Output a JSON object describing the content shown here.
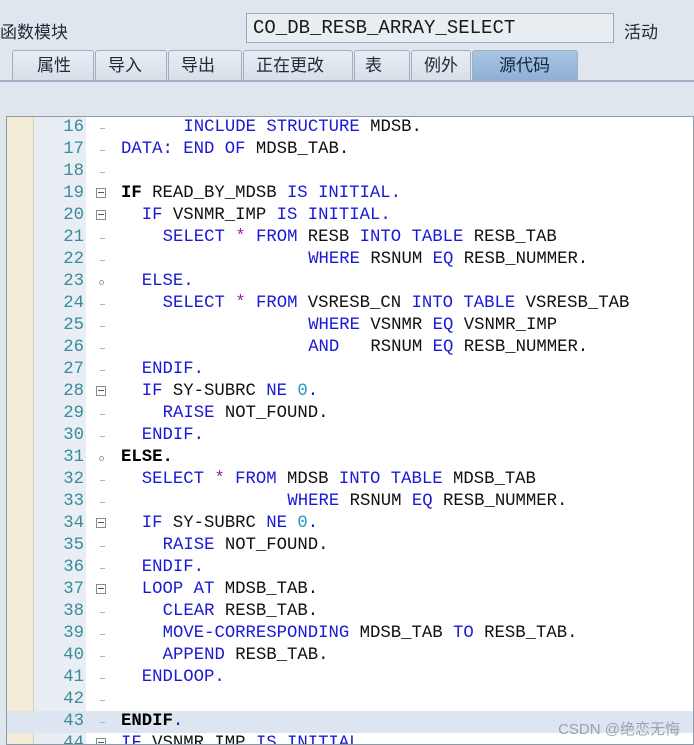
{
  "header": {
    "function_module_label": "函数模块",
    "function_module_value": "CO_DB_RESB_ARRAY_SELECT",
    "status": "活动"
  },
  "tabs": [
    {
      "label": "属性",
      "active": false
    },
    {
      "label": "导入",
      "active": false
    },
    {
      "label": "导出",
      "active": false
    },
    {
      "label": "正在更改",
      "active": false
    },
    {
      "label": "表",
      "active": false
    },
    {
      "label": "例外",
      "active": false
    },
    {
      "label": "源代码",
      "active": true
    }
  ],
  "editor": {
    "lines": [
      {
        "num": "16",
        "indent": 4,
        "tokens": [
          [
            "kw",
            "INCLUDE"
          ],
          [
            "id",
            " "
          ],
          [
            "kw",
            "STRUCTURE"
          ],
          [
            "id",
            " MDSB."
          ]
        ]
      },
      {
        "num": "17",
        "indent": 1,
        "tokens": [
          [
            "kw",
            "DATA:"
          ],
          [
            "id",
            " "
          ],
          [
            "kw",
            "END"
          ],
          [
            "id",
            " "
          ],
          [
            "kw",
            "OF"
          ],
          [
            "id",
            " MDSB_TAB."
          ]
        ]
      },
      {
        "num": "18",
        "indent": 0,
        "tokens": []
      },
      {
        "num": "19",
        "indent": 1,
        "fold": "box",
        "tokens": [
          [
            "bold",
            "IF"
          ],
          [
            "id",
            " READ_BY_MDSB "
          ],
          [
            "kw",
            "IS"
          ],
          [
            "id",
            " "
          ],
          [
            "kw",
            "INITIAL."
          ]
        ]
      },
      {
        "num": "20",
        "indent": 2,
        "fold": "box",
        "tokens": [
          [
            "kw",
            "IF"
          ],
          [
            "id",
            " VSNMR_IMP "
          ],
          [
            "kw",
            "IS"
          ],
          [
            "id",
            " "
          ],
          [
            "kw",
            "INITIAL."
          ]
        ]
      },
      {
        "num": "21",
        "indent": 3,
        "tokens": [
          [
            "kw",
            "SELECT"
          ],
          [
            "id",
            " "
          ],
          [
            "op",
            "*"
          ],
          [
            "id",
            " "
          ],
          [
            "kw",
            "FROM"
          ],
          [
            "id",
            " RESB "
          ],
          [
            "kw",
            "INTO"
          ],
          [
            "id",
            " "
          ],
          [
            "kw",
            "TABLE"
          ],
          [
            "id",
            " RESB_TAB"
          ]
        ]
      },
      {
        "num": "22",
        "indent": 10,
        "tokens": [
          [
            "kw",
            "WHERE"
          ],
          [
            "id",
            " RSNUM "
          ],
          [
            "kw",
            "EQ"
          ],
          [
            "id",
            " RESB_NUMMER."
          ]
        ]
      },
      {
        "num": "23",
        "indent": 2,
        "fold": "dot",
        "tokens": [
          [
            "kw",
            "ELSE."
          ]
        ]
      },
      {
        "num": "24",
        "indent": 3,
        "tokens": [
          [
            "kw",
            "SELECT"
          ],
          [
            "id",
            " "
          ],
          [
            "op",
            "*"
          ],
          [
            "id",
            " "
          ],
          [
            "kw",
            "FROM"
          ],
          [
            "id",
            " VSRESB_CN "
          ],
          [
            "kw",
            "INTO"
          ],
          [
            "id",
            " "
          ],
          [
            "kw",
            "TABLE"
          ],
          [
            "id",
            " VSRESB_TAB"
          ]
        ]
      },
      {
        "num": "25",
        "indent": 10,
        "tokens": [
          [
            "kw",
            "WHERE"
          ],
          [
            "id",
            " VSNMR "
          ],
          [
            "kw",
            "EQ"
          ],
          [
            "id",
            " VSNMR_IMP"
          ]
        ]
      },
      {
        "num": "26",
        "indent": 10,
        "tokens": [
          [
            "kw",
            "AND"
          ],
          [
            "id",
            "   RSNUM "
          ],
          [
            "kw",
            "EQ"
          ],
          [
            "id",
            " RESB_NUMMER."
          ]
        ]
      },
      {
        "num": "27",
        "indent": 2,
        "tokens": [
          [
            "kw",
            "ENDIF."
          ]
        ]
      },
      {
        "num": "28",
        "indent": 2,
        "fold": "box",
        "tokens": [
          [
            "kw",
            "IF"
          ],
          [
            "id",
            " SY-SUBRC "
          ],
          [
            "kw",
            "NE"
          ],
          [
            "id",
            " "
          ],
          [
            "num",
            "0"
          ],
          [
            "kw",
            "."
          ]
        ]
      },
      {
        "num": "29",
        "indent": 3,
        "tokens": [
          [
            "kw",
            "RAISE"
          ],
          [
            "id",
            " NOT_FOUND."
          ]
        ]
      },
      {
        "num": "30",
        "indent": 2,
        "tokens": [
          [
            "kw",
            "ENDIF."
          ]
        ]
      },
      {
        "num": "31",
        "indent": 1,
        "fold": "dot",
        "tokens": [
          [
            "bold",
            "ELSE."
          ]
        ]
      },
      {
        "num": "32",
        "indent": 2,
        "tokens": [
          [
            "kw",
            "SELECT"
          ],
          [
            "id",
            " "
          ],
          [
            "op",
            "*"
          ],
          [
            "id",
            " "
          ],
          [
            "kw",
            "FROM"
          ],
          [
            "id",
            " MDSB "
          ],
          [
            "kw",
            "INTO"
          ],
          [
            "id",
            " "
          ],
          [
            "kw",
            "TABLE"
          ],
          [
            "id",
            " MDSB_TAB"
          ]
        ]
      },
      {
        "num": "33",
        "indent": 9,
        "tokens": [
          [
            "kw",
            "WHERE"
          ],
          [
            "id",
            " RSNUM "
          ],
          [
            "kw",
            "EQ"
          ],
          [
            "id",
            " RESB_NUMMER."
          ]
        ]
      },
      {
        "num": "34",
        "indent": 2,
        "fold": "box",
        "tokens": [
          [
            "kw",
            "IF"
          ],
          [
            "id",
            " SY-SUBRC "
          ],
          [
            "kw",
            "NE"
          ],
          [
            "id",
            " "
          ],
          [
            "num",
            "0"
          ],
          [
            "kw",
            "."
          ]
        ]
      },
      {
        "num": "35",
        "indent": 3,
        "tokens": [
          [
            "kw",
            "RAISE"
          ],
          [
            "id",
            " NOT_FOUND."
          ]
        ]
      },
      {
        "num": "36",
        "indent": 2,
        "tokens": [
          [
            "kw",
            "ENDIF."
          ]
        ]
      },
      {
        "num": "37",
        "indent": 2,
        "fold": "box",
        "tokens": [
          [
            "kw",
            "LOOP"
          ],
          [
            "id",
            " "
          ],
          [
            "kw",
            "AT"
          ],
          [
            "id",
            " MDSB_TAB."
          ]
        ]
      },
      {
        "num": "38",
        "indent": 3,
        "tokens": [
          [
            "kw",
            "CLEAR"
          ],
          [
            "id",
            " RESB_TAB."
          ]
        ]
      },
      {
        "num": "39",
        "indent": 3,
        "tokens": [
          [
            "kw",
            "MOVE-CORRESPONDING"
          ],
          [
            "id",
            " MDSB_TAB "
          ],
          [
            "kw",
            "TO"
          ],
          [
            "id",
            " RESB_TAB."
          ]
        ]
      },
      {
        "num": "40",
        "indent": 3,
        "tokens": [
          [
            "kw",
            "APPEND"
          ],
          [
            "id",
            " RESB_TAB."
          ]
        ]
      },
      {
        "num": "41",
        "indent": 2,
        "tokens": [
          [
            "kw",
            "ENDLOOP."
          ]
        ]
      },
      {
        "num": "42",
        "indent": 0,
        "tokens": []
      },
      {
        "num": "43",
        "indent": 1,
        "highlight": true,
        "tokens": [
          [
            "bold",
            "ENDIF"
          ],
          [
            "kw",
            "."
          ]
        ]
      },
      {
        "num": "44",
        "indent": 1,
        "fold": "box",
        "tokens": [
          [
            "kw",
            "IF"
          ],
          [
            "id",
            " VSNMR_IMP "
          ],
          [
            "kw",
            "IS"
          ],
          [
            "id",
            " "
          ],
          [
            "kw",
            "INITIAL."
          ]
        ]
      }
    ]
  },
  "watermark": "CSDN @绝恋无悔"
}
